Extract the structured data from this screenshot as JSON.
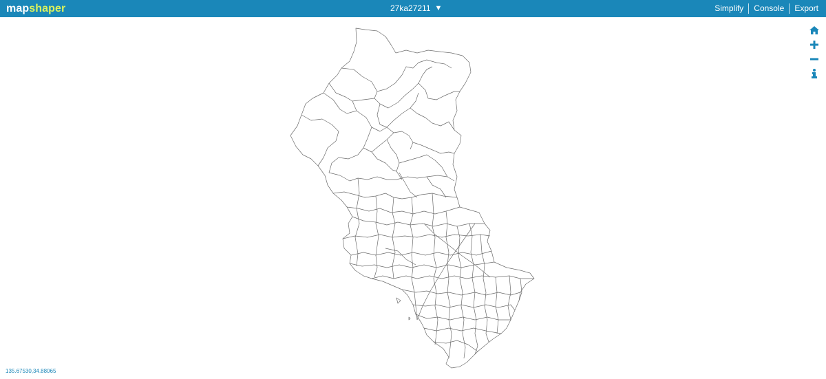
{
  "app": {
    "brand_prefix": "map",
    "brand_suffix": "shaper"
  },
  "layer_select": {
    "label": "27ka27211",
    "caret": "▼"
  },
  "nav": {
    "simplify_label": "Simplify",
    "console_label": "Console",
    "export_label": "Export"
  },
  "toolbar": {
    "home_icon": "home-icon",
    "zoom_in_icon": "plus-icon",
    "zoom_out_icon": "minus-icon",
    "info_icon": "info-icon"
  },
  "status": {
    "coordinates": "135.67530,34.88065"
  },
  "colors": {
    "header_bg": "#1a87b9",
    "brand_accent": "#d9f25e",
    "map_stroke": "#6b6b6b",
    "icon": "#1a87b9"
  }
}
